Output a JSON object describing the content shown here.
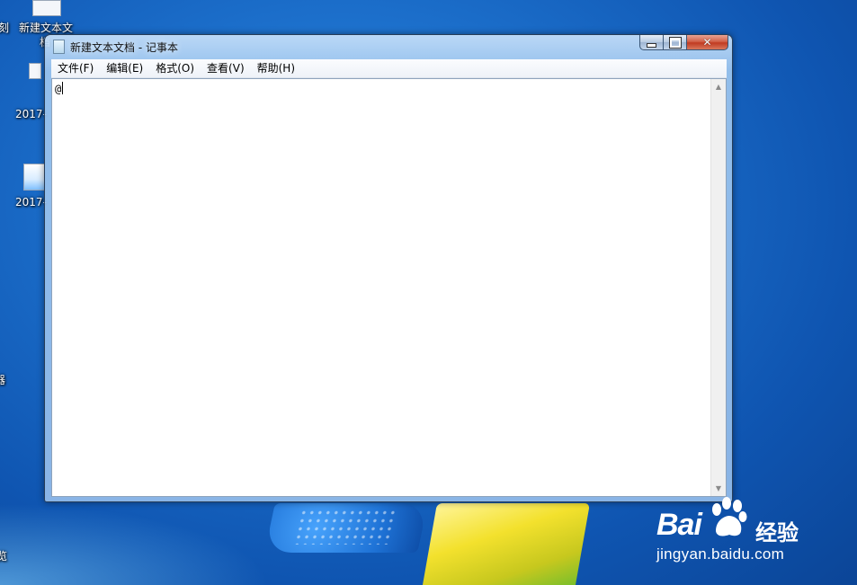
{
  "desktop": {
    "icons": [
      {
        "label": "新建文本文",
        "sublabel": "档"
      },
      {
        "label": "2017-"
      },
      {
        "label": "2017-"
      }
    ],
    "edge_labels": [
      "刻",
      "器",
      "览"
    ]
  },
  "window": {
    "title": "新建文本文档 - 记事本",
    "menu": [
      "文件(F)",
      "编辑(E)",
      "格式(O)",
      "查看(V)",
      "帮助(H)"
    ],
    "content": "@",
    "close_glyph": "✕"
  },
  "watermark": {
    "brand_left": "Bai",
    "brand_right": "du",
    "product": "经验",
    "url": "jingyan.baidu.com"
  },
  "colors": {
    "desktop_bg": "#1c6fcb",
    "close_button": "#c13b22",
    "window_frame": "#a8c8ee"
  }
}
